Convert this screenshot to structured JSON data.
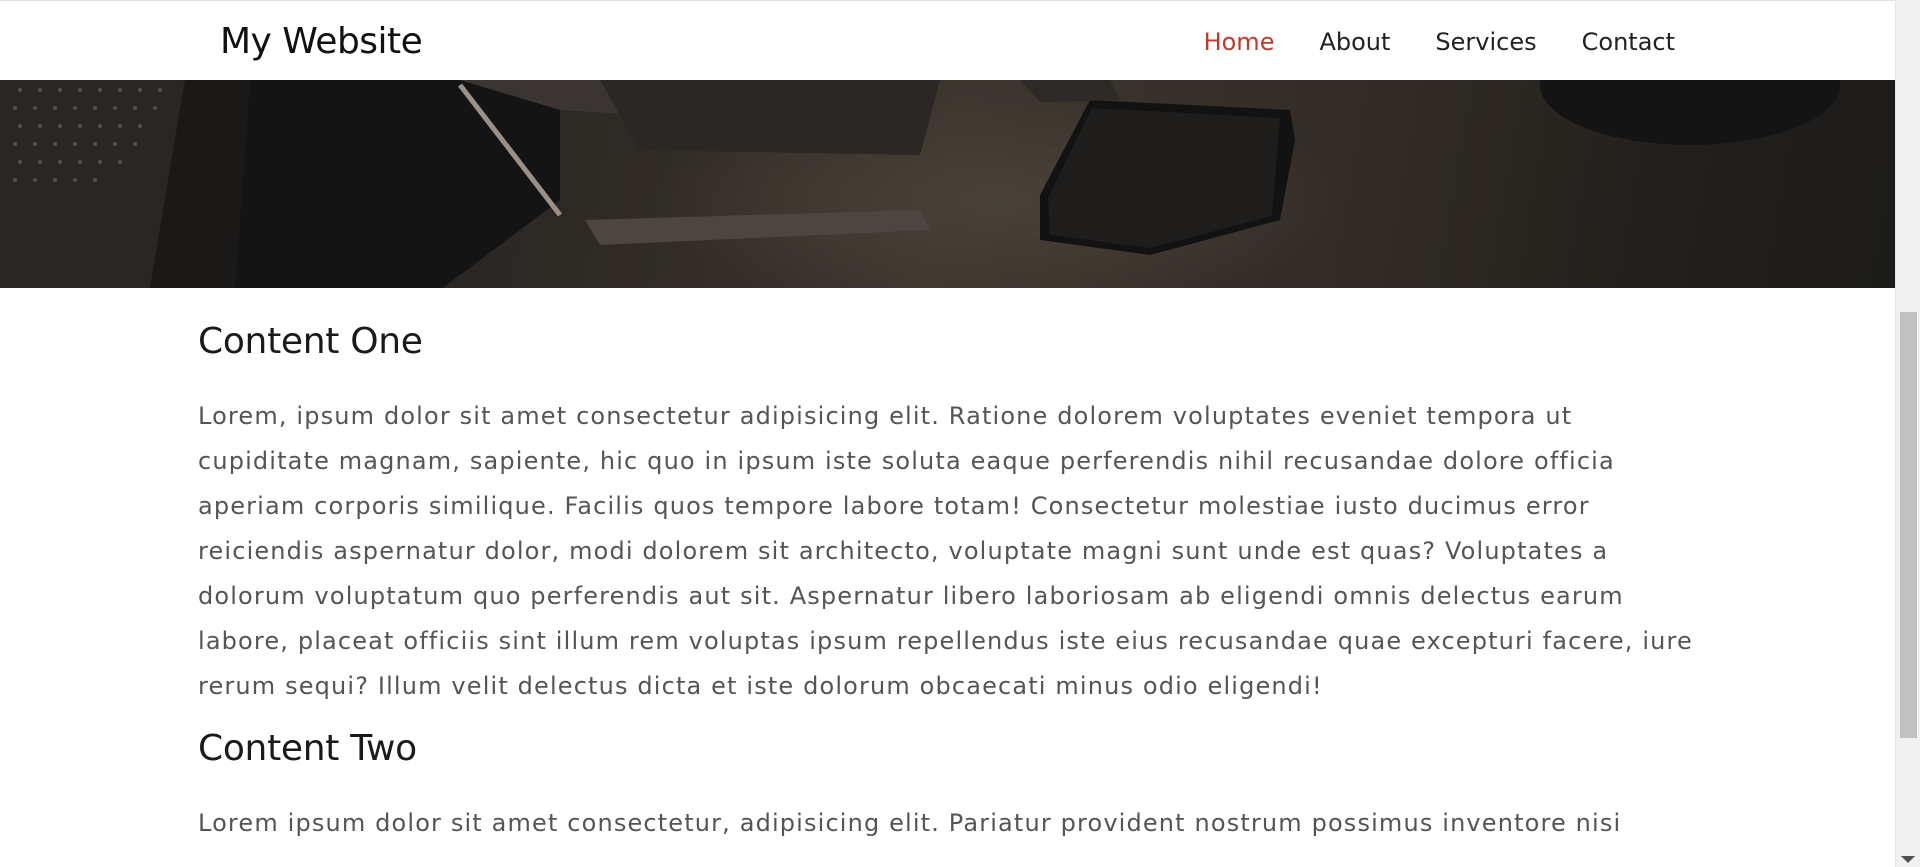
{
  "navbar": {
    "brand": "My Website",
    "links": [
      {
        "label": "Home",
        "active": true
      },
      {
        "label": "About",
        "active": false
      },
      {
        "label": "Services",
        "active": false
      },
      {
        "label": "Contact",
        "active": false
      }
    ],
    "active_color": "#c0392b"
  },
  "sections": [
    {
      "heading": "Content One",
      "body": "Lorem, ipsum dolor sit amet consectetur adipisicing elit. Ratione dolorem voluptates eveniet tempora ut cupiditate magnam, sapiente, hic quo in ipsum iste soluta eaque perferendis nihil recusandae dolore officia aperiam corporis similique. Facilis quos tempore labore totam! Consectetur molestiae iusto ducimus error reiciendis aspernatur dolor, modi dolorem sit architecto, voluptate magni sunt unde est quas? Voluptates a dolorum voluptatum quo perferendis aut sit. Aspernatur libero laboriosam ab eligendi omnis delectus earum labore, placeat officiis sint illum rem voluptas ipsum repellendus iste eius recusandae quae excepturi facere, iure rerum sequi? Illum velit delectus dicta et iste dolorum obcaecati minus odio eligendi!"
    },
    {
      "heading": "Content Two",
      "body": "Lorem ipsum dolor sit amet consectetur, adipisicing elit. Pariatur provident nostrum possimus inventore nisi"
    }
  ]
}
